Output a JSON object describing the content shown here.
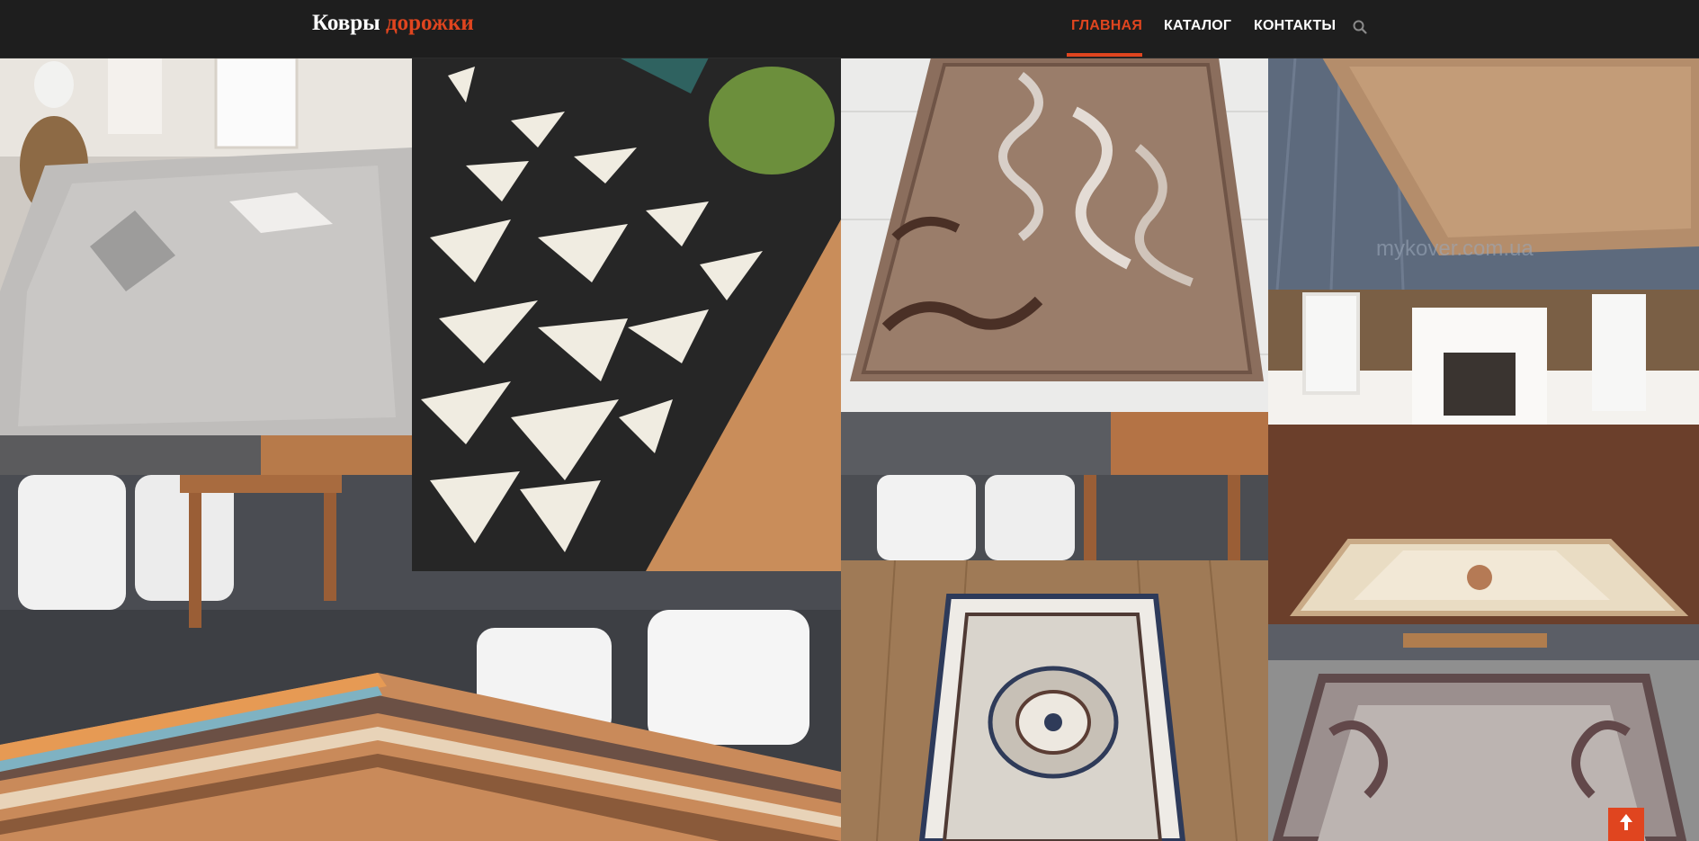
{
  "header": {
    "logo_main": "Ковры",
    "logo_accent": "дорожки",
    "nav": [
      {
        "label": "ГЛАВНАЯ",
        "active": true
      },
      {
        "label": "КАТАЛОГ",
        "active": false
      },
      {
        "label": "КОНТАКТЫ",
        "active": false
      }
    ],
    "search_icon": "search-icon"
  },
  "gallery": {
    "watermark": "mykover.com.ua",
    "tiles": [
      {
        "name": "fluffy-gray-rug-photo"
      },
      {
        "name": "black-triangle-rug-photo"
      },
      {
        "name": "brown-swirl-rug-photo"
      },
      {
        "name": "beige-shag-rug-photo"
      },
      {
        "name": "striped-fringe-rug-photo"
      },
      {
        "name": "classic-beige-rug-room-photo"
      },
      {
        "name": "white-chairs-rug-photo"
      },
      {
        "name": "medallion-rug-photo"
      },
      {
        "name": "gray-damask-rug-photo"
      }
    ]
  },
  "scroll_top_icon": "arrow-up-icon",
  "colors": {
    "accent": "#e0451f",
    "header_bg": "#1e1e1e"
  }
}
